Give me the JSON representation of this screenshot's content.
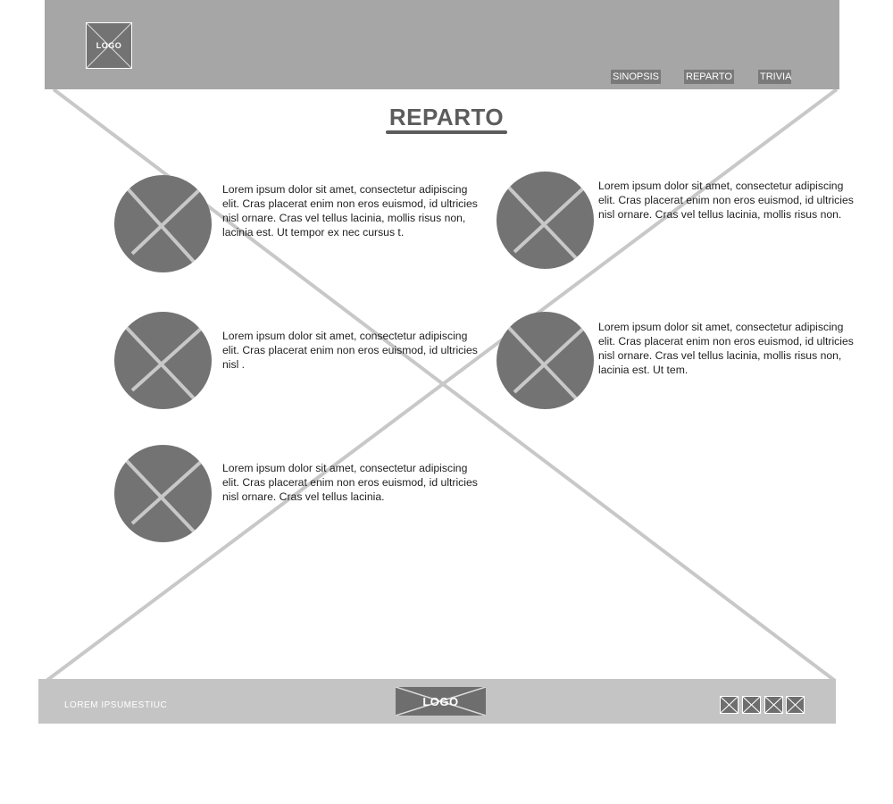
{
  "header": {
    "logo_text": "LOGO",
    "nav": [
      "SINOPSIS",
      "REPARTO",
      "TRIVIA"
    ]
  },
  "main": {
    "title": "REPARTO",
    "cast": [
      {
        "text": "Lorem ipsum dolor sit amet, consectetur adipiscing elit. Cras placerat enim non eros euismod, id ultricies nisl ornare. Cras vel tellus lacinia, mollis risus non, lacinia est. Ut tempor ex nec cursus t."
      },
      {
        "text": "Lorem ipsum dolor sit amet, consectetur adipiscing elit. Cras placerat enim non eros euismod, id ultricies nisl ornare. Cras vel tellus lacinia, mollis risus non."
      },
      {
        "text": "Lorem ipsum dolor sit amet, consectetur adipiscing elit. Cras placerat enim non eros euismod, id ultricies nisl ."
      },
      {
        "text": "Lorem ipsum dolor sit amet, consectetur adipiscing elit. Cras placerat enim non eros euismod, id ultricies nisl ornare. Cras vel tellus lacinia, mollis risus non, lacinia est. Ut tem."
      },
      {
        "text": "Lorem ipsum dolor sit amet, consectetur adipiscing elit. Cras placerat enim non eros euismod, id ultricies nisl ornare. Cras vel tellus lacinia."
      }
    ]
  },
  "footer": {
    "text": "LOREM IPSUMESTIUC",
    "logo_text": "LOGO",
    "social_icons": [
      "social-icon-1",
      "social-icon-2",
      "social-icon-3",
      "social-icon-4"
    ]
  },
  "colors": {
    "header_bg": "#a6a6a6",
    "footer_bg": "#c4c4c4",
    "placeholder": "#737373",
    "title": "#5c5c5c"
  }
}
